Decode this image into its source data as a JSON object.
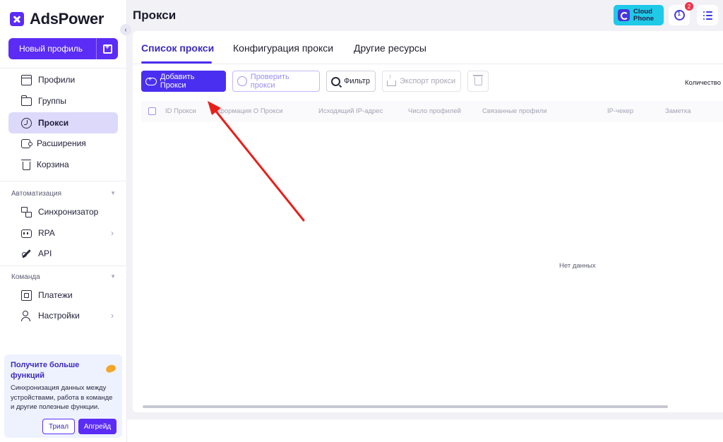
{
  "app": {
    "name": "AdsPower"
  },
  "sidebar": {
    "new_profile_label": "Новый профиль",
    "items": [
      {
        "label": "Профили",
        "icon": "profiles-icon"
      },
      {
        "label": "Группы",
        "icon": "folder-icon"
      },
      {
        "label": "Прокси",
        "icon": "proxy-icon",
        "active": true
      },
      {
        "label": "Расширения",
        "icon": "extensions-icon"
      },
      {
        "label": "Корзина",
        "icon": "trash-icon"
      }
    ],
    "automation": {
      "title": "Автоматизация",
      "items": [
        {
          "label": "Синхронизатор",
          "icon": "sync-icon"
        },
        {
          "label": "RPA",
          "icon": "rpa-icon"
        },
        {
          "label": "API",
          "icon": "api-icon"
        }
      ]
    },
    "team": {
      "title": "Команда",
      "items": [
        {
          "label": "Платежи",
          "icon": "payments-icon"
        },
        {
          "label": "Настройки",
          "icon": "users-icon"
        }
      ]
    },
    "promo": {
      "title": "Получите больше функций",
      "description": "Синхронизация данных между устройствами, работа в команде и другие полезные функции.",
      "trial_label": "Триал",
      "upgrade_label": "Апгрейд"
    }
  },
  "header": {
    "title": "Прокси",
    "cloud_phone_line1": "Cloud",
    "cloud_phone_line2": "Phone",
    "notification_count": "2"
  },
  "tabs": [
    {
      "label": "Список прокси",
      "active": true
    },
    {
      "label": "Конфигурация прокси"
    },
    {
      "label": "Другие ресурсы"
    }
  ],
  "toolbar": {
    "add_label": "Добавить Прокси",
    "check_label": "Проверить прокси",
    "filter_label": "Фильтр",
    "export_label": "Экспорт прокси",
    "count_label": "Количество п"
  },
  "table": {
    "columns": [
      "ID Прокси",
      "Информация О Прокси",
      "Исходящий IP-адрес",
      "Число профилей",
      "Связанные профили",
      "IP-чекер",
      "Заметка"
    ],
    "empty_text": "Нет данных"
  },
  "colors": {
    "accent": "#4a2ff0",
    "brand": "#5b2cf5",
    "active_nav_bg": "#dcd9fb",
    "annotation_arrow": "#e8201a"
  }
}
